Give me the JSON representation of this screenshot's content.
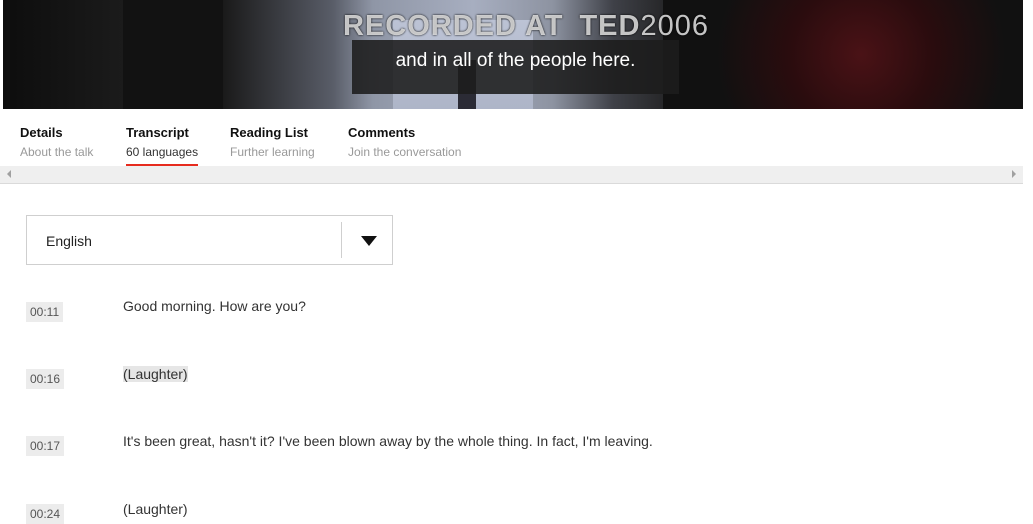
{
  "video": {
    "watermark": {
      "recorded": "RECORDED AT",
      "brand": "TED",
      "year": "2006"
    },
    "caption": "and in all of the people here."
  },
  "tabs": [
    {
      "title": "Details",
      "subtitle": "About the talk"
    },
    {
      "title": "Transcript",
      "subtitle": "60 languages"
    },
    {
      "title": "Reading List",
      "subtitle": "Further learning"
    },
    {
      "title": "Comments",
      "subtitle": "Join the conversation"
    }
  ],
  "language_select": {
    "selected": "English"
  },
  "transcript": [
    {
      "time": "00:11",
      "text": "Good morning. How are you?"
    },
    {
      "time": "00:16",
      "text": "(Laughter)"
    },
    {
      "time": "00:17",
      "text": "It's been great, hasn't it? I've been blown away by the whole thing. In fact, I'm leaving."
    },
    {
      "time": "00:24",
      "text": "(Laughter)"
    }
  ],
  "colors": {
    "accent": "#e62b1e"
  },
  "icons": {
    "select_caret": "caret-down-icon",
    "scroll_left": "scroll-left-arrow-icon",
    "scroll_right": "scroll-right-arrow-icon"
  }
}
